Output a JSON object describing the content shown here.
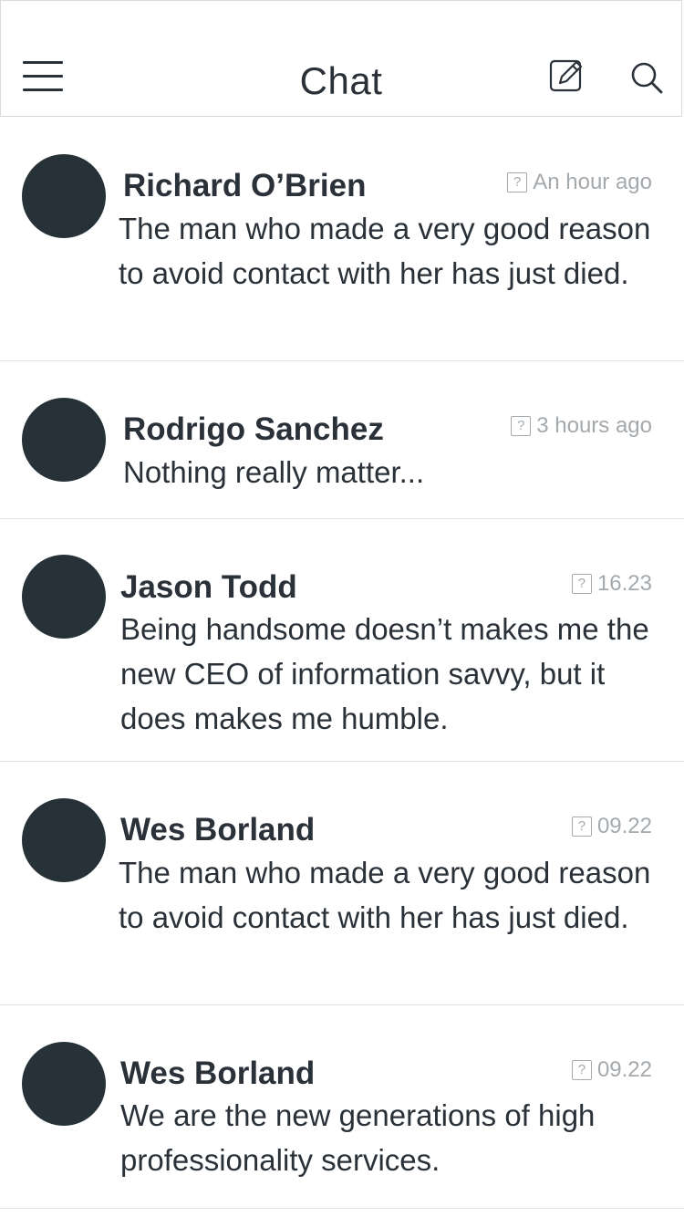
{
  "header": {
    "title": "Chat",
    "menu_icon": "hamburger-menu-icon",
    "compose_icon": "compose-edit-icon",
    "search_icon": "search-icon"
  },
  "conversations": [
    {
      "name": "Richard O’Brien",
      "time": "An hour ago",
      "message": "The man who made a very good reason to avoid contact with her has just died."
    },
    {
      "name": "Rodrigo Sanchez",
      "time": "3 hours ago",
      "message": "Nothing really matter..."
    },
    {
      "name": "Jason Todd",
      "time": "16.23",
      "message": "Being handsome doesn’t makes me the new CEO of information savvy, but it does makes me humble."
    },
    {
      "name": "Wes Borland",
      "time": "09.22",
      "message": "The man who made a very good reason to avoid contact with her has just died."
    },
    {
      "name": "Wes Borland",
      "time": "09.22",
      "message": "We are the new generations of high professionality services."
    }
  ],
  "colors": {
    "avatar": "#263238",
    "text": "#2a3139",
    "muted": "#a4a9ad",
    "divider": "#e2e2e2"
  }
}
